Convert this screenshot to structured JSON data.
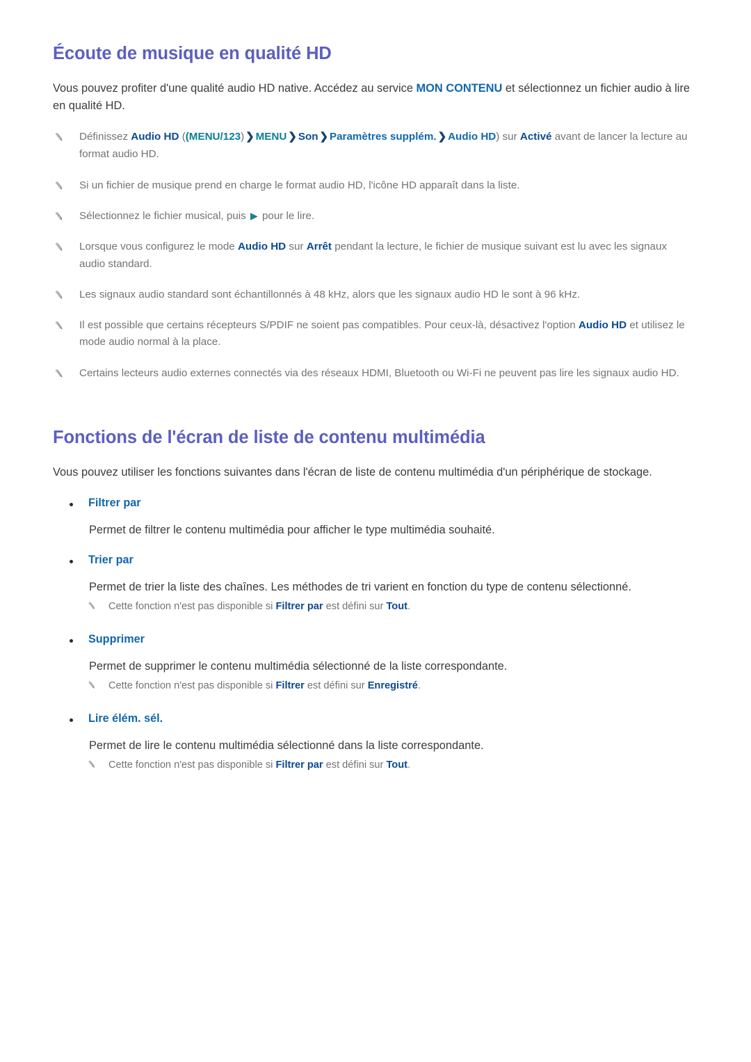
{
  "document": {
    "language": "fr",
    "accent_heading_color": "#5b5fc0",
    "accent_link_color": "#1267ad",
    "note_text_color": "#737373",
    "body_text_color": "#3b3b3b"
  },
  "sections": [
    {
      "id": "ecoute-musique-hd",
      "title": "Écoute de musique en qualité HD",
      "intro": {
        "part1": "Vous pouvez profiter d'une qualité audio HD native. Accédez au service ",
        "highlight": "MON CONTENU",
        "part2": " et sélectionnez un fichier audio à lire en qualité HD."
      },
      "notes": [
        {
          "icon": "pencil-icon",
          "segments": [
            {
              "text": "Définissez ",
              "style": "plain"
            },
            {
              "text": "Audio HD",
              "style": "navy-bold"
            },
            {
              "text": " (",
              "style": "paren"
            },
            {
              "text": "(MENU/123",
              "style": "teal-bold"
            },
            {
              "text": ")",
              "style": "paren"
            },
            {
              "text": "❯",
              "style": "chevron"
            },
            {
              "text": "MENU",
              "style": "teal-bold"
            },
            {
              "text": "❯",
              "style": "chevron"
            },
            {
              "text": "Son",
              "style": "navy-bold"
            },
            {
              "text": "❯",
              "style": "chevron"
            },
            {
              "text": "Paramètres supplém.",
              "style": "blue-bold"
            },
            {
              "text": "❯",
              "style": "chevron"
            },
            {
              "text": "Audio HD",
              "style": "blue-bold"
            },
            {
              "text": ") sur ",
              "style": "plain"
            },
            {
              "text": "Activé",
              "style": "navy-bold"
            },
            {
              "text": " avant de lancer la lecture au format audio HD.",
              "style": "plain"
            }
          ]
        },
        {
          "icon": "pencil-icon",
          "segments": [
            {
              "text": "Si un fichier de musique prend en charge le format audio HD, l'icône HD apparaît dans la liste.",
              "style": "plain"
            }
          ]
        },
        {
          "icon": "pencil-icon",
          "segments": [
            {
              "text": "Sélectionnez le fichier musical, puis ",
              "style": "plain"
            },
            {
              "text": "▶",
              "style": "play"
            },
            {
              "text": " pour le lire.",
              "style": "plain"
            }
          ]
        },
        {
          "icon": "pencil-icon",
          "segments": [
            {
              "text": "Lorsque vous configurez le mode ",
              "style": "plain"
            },
            {
              "text": "Audio HD",
              "style": "navy-bold"
            },
            {
              "text": " sur ",
              "style": "plain"
            },
            {
              "text": "Arrêt",
              "style": "navy-bold"
            },
            {
              "text": " pendant la lecture, le fichier de musique suivant est lu avec les signaux audio standard.",
              "style": "plain"
            }
          ]
        },
        {
          "icon": "pencil-icon",
          "segments": [
            {
              "text": "Les signaux audio standard sont échantillonnés à 48 kHz, alors que les signaux audio HD le sont à 96 kHz.",
              "style": "plain"
            }
          ]
        },
        {
          "icon": "pencil-icon",
          "segments": [
            {
              "text": "Il est possible que certains récepteurs S/PDIF ne soient pas compatibles. Pour ceux-là, désactivez l'option ",
              "style": "plain"
            },
            {
              "text": "Audio HD",
              "style": "navy-bold"
            },
            {
              "text": " et utilisez le mode audio normal à la place.",
              "style": "plain"
            }
          ]
        },
        {
          "icon": "pencil-icon",
          "segments": [
            {
              "text": "Certains lecteurs audio externes connectés via des réseaux HDMI, Bluetooth ou Wi-Fi ne peuvent pas lire les signaux audio HD.",
              "style": "plain"
            }
          ]
        }
      ]
    },
    {
      "id": "fonctions-ecran-liste",
      "title": "Fonctions de l'écran de liste de contenu multimédia",
      "intro": "Vous pouvez utiliser les fonctions suivantes dans l'écran de liste de contenu multimédia d'un périphérique de stockage.",
      "items": [
        {
          "label": "Filtrer par",
          "description": "Permet de filtrer le contenu multimédia pour afficher le type multimédia souhaité.",
          "subnotes": []
        },
        {
          "label": "Trier par",
          "description": "Permet de trier la liste des chaînes. Les méthodes de tri varient en fonction du type de contenu sélectionné.",
          "subnotes": [
            {
              "icon": "pencil-icon",
              "segments": [
                {
                  "text": "Cette fonction n'est pas disponible si ",
                  "style": "plain"
                },
                {
                  "text": "Filtrer par",
                  "style": "navy-bold"
                },
                {
                  "text": " est défini sur ",
                  "style": "plain"
                },
                {
                  "text": "Tout",
                  "style": "navy-bold"
                },
                {
                  "text": ".",
                  "style": "plain"
                }
              ]
            }
          ]
        },
        {
          "label": "Supprimer",
          "description": "Permet de supprimer le contenu multimédia sélectionné de la liste correspondante.",
          "subnotes": [
            {
              "icon": "pencil-icon",
              "segments": [
                {
                  "text": "Cette fonction n'est pas disponible si ",
                  "style": "plain"
                },
                {
                  "text": "Filtrer",
                  "style": "navy-bold"
                },
                {
                  "text": " est défini sur ",
                  "style": "plain"
                },
                {
                  "text": "Enregistré",
                  "style": "navy-bold"
                },
                {
                  "text": ".",
                  "style": "plain"
                }
              ]
            }
          ]
        },
        {
          "label": "Lire élém. sél.",
          "description": "Permet de lire le contenu multimédia sélectionné dans la liste correspondante.",
          "subnotes": [
            {
              "icon": "pencil-icon",
              "segments": [
                {
                  "text": "Cette fonction n'est pas disponible si ",
                  "style": "plain"
                },
                {
                  "text": "Filtrer par",
                  "style": "navy-bold"
                },
                {
                  "text": " est défini sur ",
                  "style": "plain"
                },
                {
                  "text": "Tout",
                  "style": "navy-bold"
                },
                {
                  "text": ".",
                  "style": "plain"
                }
              ]
            }
          ]
        }
      ]
    }
  ]
}
